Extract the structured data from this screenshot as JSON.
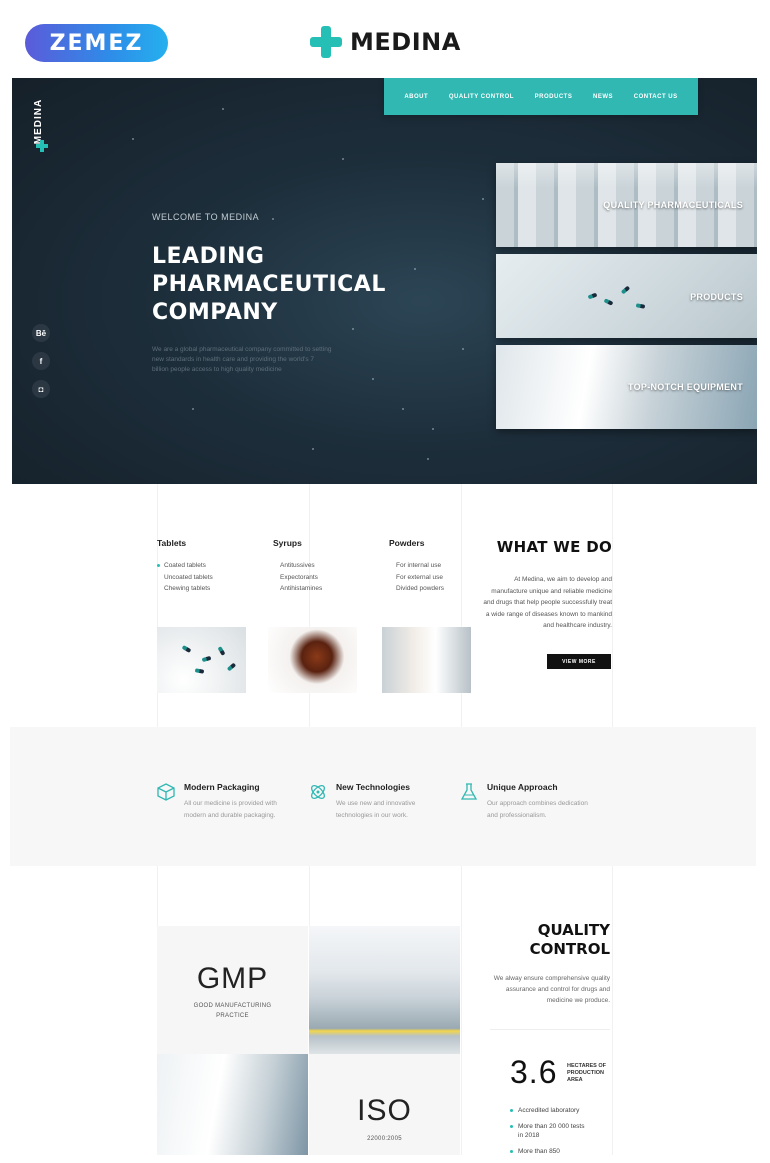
{
  "zemez_logo": "ZEMEZ",
  "brand": "MEDINA",
  "colors": {
    "accent": "#31b8b3",
    "hero_bg": "#1d2e3b",
    "dark": "#111111"
  },
  "hero": {
    "side_brand": "MEDINA",
    "nav": [
      "ABOUT",
      "QUALITY CONTROL",
      "PRODUCTS",
      "NEWS",
      "CONTACT US"
    ],
    "welcome": "WELCOME TO MEDINA",
    "title": "LEADING PHARMACEUTICAL COMPANY",
    "description": "We are a global pharmaceutical company committed to setting new standards in health care and providing the world's 7 billion people access to high quality medicine",
    "social": [
      "Bē",
      "f",
      "◘"
    ],
    "cards": [
      "QUALITY PHARMACEUTICALS",
      "PRODUCTS",
      "TOP-NOTCH EQUIPMENT"
    ]
  },
  "products": {
    "categories": [
      {
        "title": "Tablets",
        "items": [
          "Coated tablets",
          "Uncoated tablets",
          "Chewing tablets"
        ]
      },
      {
        "title": "Syrups",
        "items": [
          "Antitussives",
          "Expectorants",
          "Antihistamines"
        ]
      },
      {
        "title": "Powders",
        "items": [
          "For internal use",
          "For external use",
          "Divided powders"
        ]
      }
    ],
    "heading": "WHAT WE DO",
    "description": "At Medina, we aim to develop and manufacture unique and reliable medicine and drugs that help people successfully treat a wide range of diseases known to mankind and healthcare industry.",
    "button": "VIEW MORE"
  },
  "features": [
    {
      "icon": "cube-icon",
      "title": "Modern Packaging",
      "text": "All our medicine is provided with modern and durable packaging."
    },
    {
      "icon": "molecule-icon",
      "title": "New Technologies",
      "text": "We use new and innovative technologies in our work."
    },
    {
      "icon": "flask-icon",
      "title": "Unique Approach",
      "text": "Our approach combines dedication and professionalism."
    }
  ],
  "quality": {
    "gmp": "GMP",
    "gmp_sub": "GOOD MANUFACTURING PRACTICE",
    "iso": "ISO",
    "iso_sub": "22000:2005",
    "heading": "QUALITY CONTROL",
    "description": "We alway ensure comprehensive quality assurance and control for drugs and medicine we produce.",
    "stat_value": "3.6",
    "stat_label": "HECTARES OF PRODUCTION AREA",
    "list": [
      "Accredited laboratory",
      "More than 20 000 tests in 2018",
      "More than 850"
    ]
  }
}
